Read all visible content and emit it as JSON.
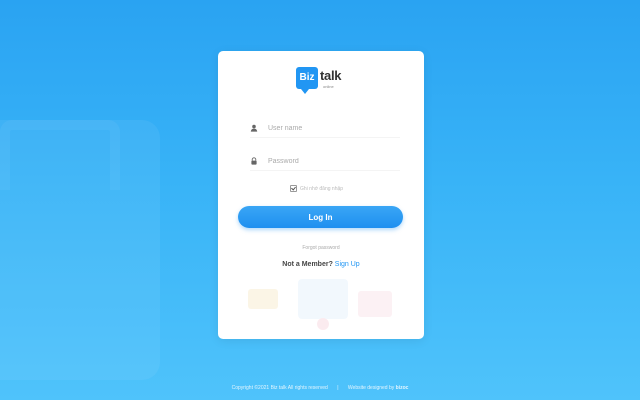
{
  "logo": {
    "badge": "Biz",
    "word": "talk",
    "sub": "online"
  },
  "form": {
    "username_placeholder": "User name",
    "password_placeholder": "Password",
    "remember_label": "Ghi nhớ đăng nhập",
    "login_label": "Log In",
    "forgot_label": "Forgot password",
    "signup_prompt": "Not a Member?",
    "signup_link": "Sign Up"
  },
  "footer": {
    "copyright": "Copyright ©2021 Biz talk All rights reserved",
    "separator": "|",
    "designed_by": "Website designed by",
    "designer": "bizoc"
  },
  "colors": {
    "accent": "#2196f3",
    "background": "#38b3f7"
  },
  "icons": {
    "user": "user-icon",
    "password": "lock-icon",
    "remember": "checkbox-icon"
  }
}
